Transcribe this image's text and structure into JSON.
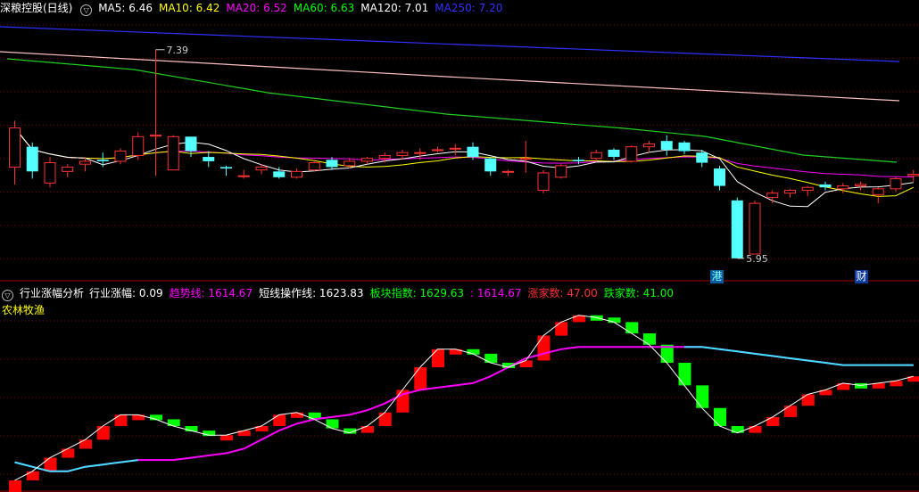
{
  "top_panel": {
    "title": "深粮控股(日线)",
    "ma_items": [
      {
        "label": "MA5: 6.46",
        "color": "#ffffff"
      },
      {
        "label": "MA10: 6.42",
        "color": "#ffff00"
      },
      {
        "label": "MA20: 6.52",
        "color": "#ff00ff"
      },
      {
        "label": "MA60: 6.63",
        "color": "#00ff00"
      },
      {
        "label": "MA120: 7.01",
        "color": "#ffffff"
      },
      {
        "label": "MA250: 7.20",
        "color": "#3030ff"
      }
    ],
    "high_label": "7.39",
    "low_label": "5.95",
    "tag_gang": "港",
    "tag_cai": "财"
  },
  "bottom_panel": {
    "indicator_name": "行业涨幅分析",
    "items": [
      {
        "label": "行业涨幅: 0.09",
        "color": "#ffffff"
      },
      {
        "label": "趋势线: 1614.67",
        "color": "#ff00ff"
      },
      {
        "label": "短线操作线: 1623.83",
        "color": "#ffffff"
      },
      {
        "label": "板块指数: 1629.63",
        "color": "#00ff00"
      },
      {
        "label": ": 1614.67",
        "color": "#ff00ff"
      },
      {
        "label": "涨家数: 47.00",
        "color": "#ff3030"
      },
      {
        "label": "跌家数: 41.00",
        "color": "#00ff00"
      }
    ],
    "sector_label": "农林牧渔"
  },
  "colors": {
    "up": "#ff3232",
    "down_fill": "#54ffff",
    "sector_up": "#ff0000",
    "sector_down": "#00ff00",
    "grid": "#800000"
  },
  "chart_data": [
    {
      "type": "candlestick",
      "title": "深粮控股(日线)",
      "y_axis": "price",
      "y_range": [
        5.9,
        7.45
      ],
      "candles": [
        [
          6.58,
          6.85,
          6.9,
          6.46
        ],
        [
          6.72,
          6.55,
          6.75,
          6.5
        ],
        [
          6.47,
          6.61,
          6.65,
          6.44
        ],
        [
          6.55,
          6.58,
          6.6,
          6.51
        ],
        [
          6.6,
          6.62,
          6.65,
          6.55
        ],
        [
          6.63,
          6.62,
          6.68,
          6.58
        ],
        [
          6.62,
          6.69,
          6.71,
          6.6
        ],
        [
          6.66,
          6.79,
          6.82,
          6.63
        ],
        [
          6.8,
          6.8,
          7.39,
          6.52
        ],
        [
          6.56,
          6.79,
          6.8,
          6.56
        ],
        [
          6.79,
          6.69,
          6.79,
          6.65
        ],
        [
          6.65,
          6.62,
          6.69,
          6.58
        ],
        [
          6.58,
          6.57,
          6.59,
          6.52
        ],
        [
          6.52,
          6.52,
          6.56,
          6.5
        ],
        [
          6.56,
          6.58,
          6.6,
          6.53
        ],
        [
          6.55,
          6.51,
          6.58,
          6.5
        ],
        [
          6.51,
          6.55,
          6.57,
          6.5
        ],
        [
          6.56,
          6.61,
          6.63,
          6.55
        ],
        [
          6.63,
          6.58,
          6.65,
          6.56
        ],
        [
          6.59,
          6.62,
          6.64,
          6.57
        ],
        [
          6.62,
          6.64,
          6.65,
          6.6
        ],
        [
          6.64,
          6.66,
          6.68,
          6.61
        ],
        [
          6.66,
          6.68,
          6.7,
          6.63
        ],
        [
          6.68,
          6.68,
          6.71,
          6.63
        ],
        [
          6.7,
          6.7,
          6.72,
          6.68
        ],
        [
          6.71,
          6.71,
          6.74,
          6.66
        ],
        [
          6.72,
          6.65,
          6.75,
          6.63
        ],
        [
          6.64,
          6.55,
          6.65,
          6.52
        ],
        [
          6.55,
          6.55,
          6.56,
          6.52
        ],
        [
          6.64,
          6.64,
          6.76,
          6.54
        ],
        [
          6.42,
          6.54,
          6.56,
          6.4
        ],
        [
          6.51,
          6.59,
          6.6,
          6.5
        ],
        [
          6.63,
          6.62,
          6.65,
          6.6
        ],
        [
          6.64,
          6.68,
          6.7,
          6.62
        ],
        [
          6.7,
          6.65,
          6.71,
          6.63
        ],
        [
          6.62,
          6.72,
          6.73,
          6.61
        ],
        [
          6.72,
          6.74,
          6.76,
          6.68
        ],
        [
          6.76,
          6.7,
          6.8,
          6.66
        ],
        [
          6.75,
          6.69,
          6.76,
          6.67
        ],
        [
          6.68,
          6.61,
          6.7,
          6.58
        ],
        [
          6.57,
          6.45,
          6.59,
          6.42
        ],
        [
          6.35,
          5.95,
          6.37,
          5.95
        ],
        [
          5.98,
          6.33,
          6.35,
          5.98
        ],
        [
          6.37,
          6.4,
          6.42,
          6.33
        ],
        [
          6.4,
          6.42,
          6.43,
          6.37
        ],
        [
          6.42,
          6.44,
          6.45,
          6.38
        ],
        [
          6.46,
          6.44,
          6.48,
          6.42
        ],
        [
          6.43,
          6.45,
          6.47,
          6.4
        ],
        [
          6.45,
          6.46,
          6.48,
          6.42
        ],
        [
          6.39,
          6.43,
          6.44,
          6.33
        ],
        [
          6.43,
          6.5,
          6.51,
          6.41
        ],
        [
          6.52,
          6.53,
          6.56,
          6.48
        ]
      ]
    },
    {
      "type": "bar",
      "title": "行业涨幅分析",
      "series": [
        {
          "name": "趋势线",
          "values": [
            1450,
            1440,
            1430,
            1430,
            1440,
            1445,
            1450,
            1455,
            1455,
            1455,
            1460,
            1465,
            1470,
            1480,
            1500,
            1520,
            1535,
            1545,
            1550,
            1555,
            1565,
            1580,
            1600,
            1610,
            1615,
            1620,
            1625,
            1640,
            1660,
            1680,
            1690,
            1700,
            1705,
            1705,
            1705,
            1705,
            1705,
            1705,
            1705,
            1705,
            1700,
            1695,
            1690,
            1685,
            1680,
            1675,
            1670,
            1665,
            1665,
            1665,
            1665,
            1665
          ]
        },
        {
          "name": "短线操作线",
          "values": [
            1410,
            1430,
            1460,
            1480,
            1500,
            1530,
            1555,
            1555,
            1545,
            1530,
            1520,
            1510,
            1510,
            1520,
            1530,
            1555,
            1560,
            1545,
            1525,
            1515,
            1530,
            1560,
            1610,
            1660,
            1700,
            1700,
            1690,
            1670,
            1660,
            1675,
            1730,
            1760,
            1775,
            1770,
            1760,
            1735,
            1710,
            1670,
            1620,
            1570,
            1530,
            1515,
            1530,
            1550,
            1575,
            1600,
            1610,
            1625,
            1620,
            1625,
            1630,
            1640
          ]
        }
      ]
    }
  ]
}
